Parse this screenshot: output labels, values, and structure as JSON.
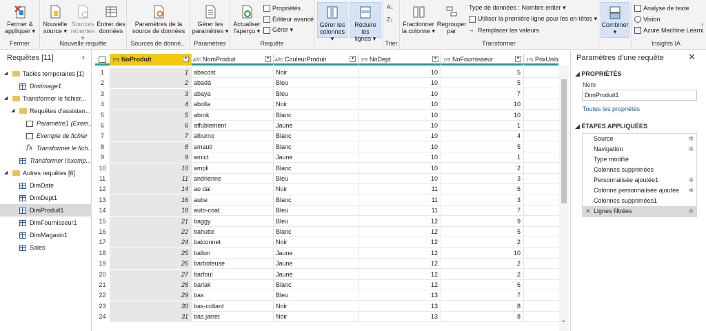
{
  "ribbon": {
    "groups": {
      "fermer": "Fermer",
      "nouvelle_requete": "Nouvelle requête",
      "sources": "Sources de donné...",
      "parametres": "Paramètres",
      "requete": "Requête",
      "trier": "Trier",
      "transformer": "Transformer",
      "insights": "Insights IA"
    },
    "buttons": {
      "fermer_l1": "Fermer &",
      "fermer_l2": "appliquer ▾",
      "nouvelle_l1": "Nouvelle",
      "nouvelle_l2": "source ▾",
      "recentes_l1": "Sources",
      "recentes_l2": "récentes ▾",
      "entrer_l1": "Entrer des",
      "entrer_l2": "données",
      "paramsrc_l1": "Paramètres de la",
      "paramsrc_l2": "source de données",
      "gererparam_l1": "Gérer les",
      "gererparam_l2": "paramètres ▾",
      "actualiser_l1": "Actualiser",
      "actualiser_l2": "l'aperçu ▾",
      "proprietes": "Propriétés",
      "editeur": "Éditeur avancé",
      "gerer": "Gérer ▾",
      "gerercol_l1": "Gérer les",
      "gerercol_l2": "colonnes ▾",
      "reduire_l1": "Réduire les",
      "reduire_l2": "lignes ▾",
      "fractionner_l1": "Fractionner",
      "fractionner_l2": "la colonne ▾",
      "regrouper_l1": "Regrouper",
      "regrouper_l2": "par",
      "type_donnees": "Type de données : Nombre entier ▾",
      "premiere_ligne": "Utiliser la première ligne pour les en-têtes ▾",
      "remplacer": "Remplacer les valeurs",
      "combiner": "Combiner",
      "analyse_texte": "Analyse de texte",
      "vision": "Vision",
      "azure_ml": "Azure Machine Learni"
    }
  },
  "left_panel": {
    "title": "Requêtes [11]",
    "tree": [
      {
        "label": "Tables temporaires [1]",
        "kind": "folder",
        "level": 0
      },
      {
        "label": "DimImage1",
        "kind": "table",
        "level": 1,
        "italic": true
      },
      {
        "label": "Transformer le fichier...",
        "kind": "folder",
        "level": 0
      },
      {
        "label": "Requêtes d'assistan...",
        "kind": "folder",
        "level": 1
      },
      {
        "label": "Paramètre1 (Exem...",
        "kind": "param",
        "level": 2,
        "italic": true
      },
      {
        "label": "Exemple de fichier",
        "kind": "param",
        "level": 2,
        "italic": true
      },
      {
        "label": "Transformer le fich...",
        "kind": "fx",
        "level": 2,
        "italic": true
      },
      {
        "label": "Transformer l'exemp...",
        "kind": "table",
        "level": 1,
        "italic": true
      },
      {
        "label": "Autres requêtes [6]",
        "kind": "folder",
        "level": 0
      },
      {
        "label": "DimDate",
        "kind": "table",
        "level": 1
      },
      {
        "label": "DimDept1",
        "kind": "table",
        "level": 1
      },
      {
        "label": "DimProduit1",
        "kind": "table",
        "level": 1,
        "selected": true
      },
      {
        "label": "DimFournisseur1",
        "kind": "table",
        "level": 1
      },
      {
        "label": "DimMagasin1",
        "kind": "table",
        "level": 1
      },
      {
        "label": "Sales",
        "kind": "table",
        "level": 1
      }
    ]
  },
  "grid": {
    "columns": [
      {
        "type": "1²3",
        "name": "NoProduit",
        "selected": true
      },
      {
        "type": "AᴮC",
        "name": "NomProduit"
      },
      {
        "type": "AᴮC",
        "name": "CouleurProduit"
      },
      {
        "type": "1²3",
        "name": "NoDept"
      },
      {
        "type": "1²3",
        "name": "NoFournisseur"
      },
      {
        "type": "1²3",
        "name": "PrixUnitaire"
      }
    ],
    "rows": [
      [
        "1",
        "abacost",
        "Noir",
        "10",
        "5"
      ],
      [
        "2",
        "abadá",
        "Bleu",
        "10",
        "5"
      ],
      [
        "3",
        "abaya",
        "Bleu",
        "10",
        "7"
      ],
      [
        "4",
        "abolla",
        "Noir",
        "10",
        "10"
      ],
      [
        "5",
        "abrok",
        "Blanc",
        "10",
        "10"
      ],
      [
        "6",
        "affublement",
        "Jaune",
        "10",
        "1"
      ],
      [
        "7",
        "alburno",
        "Blanc",
        "10",
        "4"
      ],
      [
        "8",
        "amauti",
        "Blanc",
        "10",
        "5"
      ],
      [
        "9",
        "amict",
        "Jaune",
        "10",
        "1"
      ],
      [
        "10",
        "ampli",
        "Blanc",
        "10",
        "2"
      ],
      [
        "11",
        "andrienne",
        "Bleu",
        "10",
        "3"
      ],
      [
        "14",
        "ao dai",
        "Noir",
        "11",
        "6"
      ],
      [
        "16",
        "aube",
        "Blanc",
        "11",
        "3"
      ],
      [
        "18",
        "auto-coat",
        "Bleu",
        "11",
        "7"
      ],
      [
        "21",
        "baggy",
        "Bleu",
        "12",
        "9"
      ],
      [
        "22",
        "bahutte",
        "Blanc",
        "12",
        "5"
      ],
      [
        "24",
        "balconnet",
        "Noir",
        "12",
        "2"
      ],
      [
        "25",
        "ballon",
        "Jaune",
        "12",
        "10"
      ],
      [
        "26",
        "barboteuse",
        "Jaune",
        "12",
        "2"
      ],
      [
        "27",
        "barfoul",
        "Jaune",
        "12",
        "2"
      ],
      [
        "28",
        "barlak",
        "Blanc",
        "12",
        "6"
      ],
      [
        "29",
        "bas",
        "Bleu",
        "13",
        "7"
      ],
      [
        "30",
        "bas-collant",
        "Noir",
        "13",
        "8"
      ],
      [
        "31",
        "bas jarret",
        "Noir",
        "13",
        "8"
      ]
    ]
  },
  "right_panel": {
    "title": "Paramètres d'une requête",
    "proprietes": "PROPRIÉTÉS",
    "nom_label": "Nom",
    "nom_value": "DimProduit1",
    "toutes": "Toutes les propriétés",
    "etapes": "ÉTAPES APPLIQUÉES",
    "steps": [
      {
        "label": "Source",
        "gear": true
      },
      {
        "label": "Navigation",
        "gear": true
      },
      {
        "label": "Type modifié",
        "gear": false
      },
      {
        "label": "Colonnes supprimées",
        "gear": false
      },
      {
        "label": "Personnalisée ajoutée1",
        "gear": true
      },
      {
        "label": "Colonne personnalisée ajoutée",
        "gear": true
      },
      {
        "label": "Colonnes supprimées1",
        "gear": false
      },
      {
        "label": "Lignes filtrées",
        "gear": true,
        "selected": true
      }
    ]
  },
  "colors": {
    "accent_yellow": "#f2c811",
    "teal": "#1aa093",
    "link": "#1e5aa0"
  }
}
